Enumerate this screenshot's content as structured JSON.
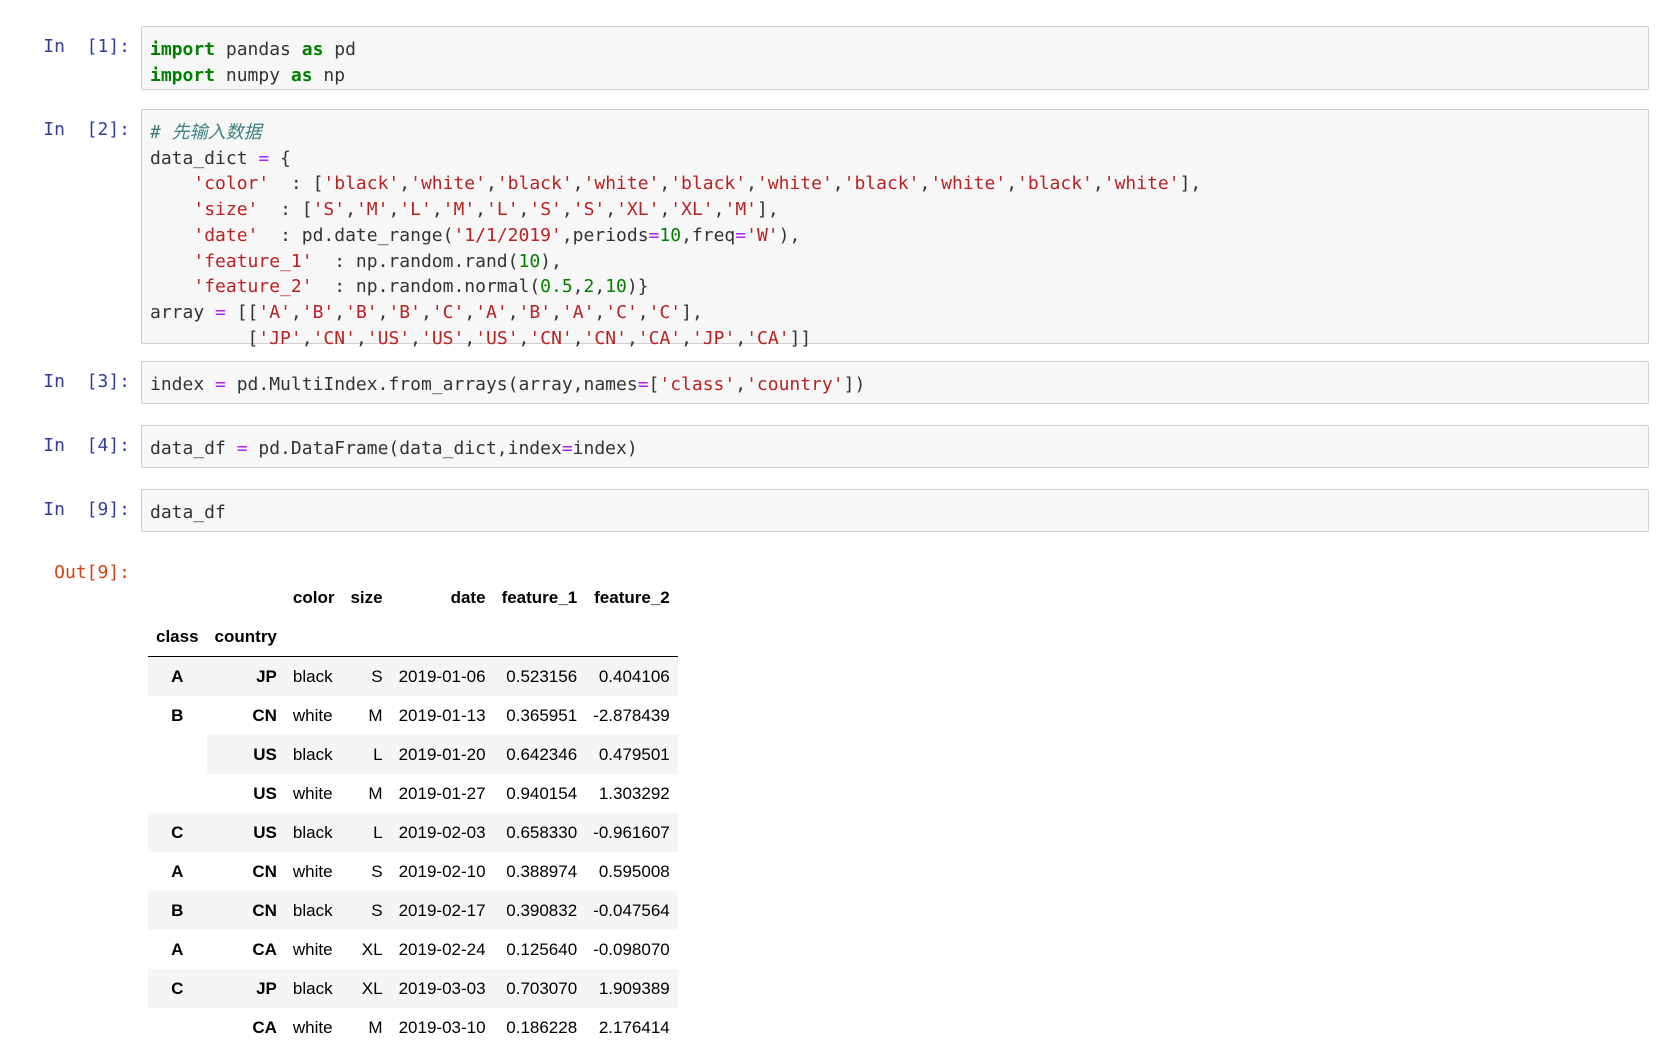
{
  "cells": [
    {
      "prompt": "In  [1]:",
      "lines": [
        [
          [
            "kw",
            "import"
          ],
          [
            "t",
            " pandas "
          ],
          [
            "kw",
            "as"
          ],
          [
            "t",
            " pd"
          ]
        ],
        [
          [
            "kw",
            "import"
          ],
          [
            "t",
            " numpy "
          ],
          [
            "kw",
            "as"
          ],
          [
            "t",
            " np"
          ]
        ]
      ]
    },
    {
      "prompt": "In  [2]:",
      "lines": [
        [
          [
            "cm",
            "# 先输入数据"
          ]
        ],
        [
          [
            "t",
            "data_dict "
          ],
          [
            "op",
            "="
          ],
          [
            "t",
            " {"
          ]
        ],
        [
          [
            "t",
            "    "
          ],
          [
            "str",
            "'color'"
          ],
          [
            "t",
            "  : ["
          ],
          [
            "str",
            "'black'"
          ],
          [
            "t",
            ","
          ],
          [
            "str",
            "'white'"
          ],
          [
            "t",
            ","
          ],
          [
            "str",
            "'black'"
          ],
          [
            "t",
            ","
          ],
          [
            "str",
            "'white'"
          ],
          [
            "t",
            ","
          ],
          [
            "str",
            "'black'"
          ],
          [
            "t",
            ","
          ],
          [
            "str",
            "'white'"
          ],
          [
            "t",
            ","
          ],
          [
            "str",
            "'black'"
          ],
          [
            "t",
            ","
          ],
          [
            "str",
            "'white'"
          ],
          [
            "t",
            ","
          ],
          [
            "str",
            "'black'"
          ],
          [
            "t",
            ","
          ],
          [
            "str",
            "'white'"
          ],
          [
            "t",
            "],"
          ]
        ],
        [
          [
            "t",
            "    "
          ],
          [
            "str",
            "'size'"
          ],
          [
            "t",
            "  : ["
          ],
          [
            "str",
            "'S'"
          ],
          [
            "t",
            ","
          ],
          [
            "str",
            "'M'"
          ],
          [
            "t",
            ","
          ],
          [
            "str",
            "'L'"
          ],
          [
            "t",
            ","
          ],
          [
            "str",
            "'M'"
          ],
          [
            "t",
            ","
          ],
          [
            "str",
            "'L'"
          ],
          [
            "t",
            ","
          ],
          [
            "str",
            "'S'"
          ],
          [
            "t",
            ","
          ],
          [
            "str",
            "'S'"
          ],
          [
            "t",
            ","
          ],
          [
            "str",
            "'XL'"
          ],
          [
            "t",
            ","
          ],
          [
            "str",
            "'XL'"
          ],
          [
            "t",
            ","
          ],
          [
            "str",
            "'M'"
          ],
          [
            "t",
            "],"
          ]
        ],
        [
          [
            "t",
            "    "
          ],
          [
            "str",
            "'date'"
          ],
          [
            "t",
            "  : pd.date_range("
          ],
          [
            "str",
            "'1/1/2019'"
          ],
          [
            "t",
            ",periods"
          ],
          [
            "op",
            "="
          ],
          [
            "num",
            "10"
          ],
          [
            "t",
            ",freq"
          ],
          [
            "op",
            "="
          ],
          [
            "str",
            "'W'"
          ],
          [
            "t",
            "),"
          ]
        ],
        [
          [
            "t",
            "    "
          ],
          [
            "str",
            "'feature_1'"
          ],
          [
            "t",
            "  : np.random.rand("
          ],
          [
            "num",
            "10"
          ],
          [
            "t",
            "),"
          ]
        ],
        [
          [
            "t",
            "    "
          ],
          [
            "str",
            "'feature_2'"
          ],
          [
            "t",
            "  : np.random.normal("
          ],
          [
            "num",
            "0.5"
          ],
          [
            "t",
            ","
          ],
          [
            "num",
            "2"
          ],
          [
            "t",
            ","
          ],
          [
            "num",
            "10"
          ],
          [
            "t",
            ")}"
          ]
        ],
        [
          [
            "t",
            "array "
          ],
          [
            "op",
            "="
          ],
          [
            "t",
            " [["
          ],
          [
            "str",
            "'A'"
          ],
          [
            "t",
            ","
          ],
          [
            "str",
            "'B'"
          ],
          [
            "t",
            ","
          ],
          [
            "str",
            "'B'"
          ],
          [
            "t",
            ","
          ],
          [
            "str",
            "'B'"
          ],
          [
            "t",
            ","
          ],
          [
            "str",
            "'C'"
          ],
          [
            "t",
            ","
          ],
          [
            "str",
            "'A'"
          ],
          [
            "t",
            ","
          ],
          [
            "str",
            "'B'"
          ],
          [
            "t",
            ","
          ],
          [
            "str",
            "'A'"
          ],
          [
            "t",
            ","
          ],
          [
            "str",
            "'C'"
          ],
          [
            "t",
            ","
          ],
          [
            "str",
            "'C'"
          ],
          [
            "t",
            "],"
          ]
        ],
        [
          [
            "t",
            "         ["
          ],
          [
            "str",
            "'JP'"
          ],
          [
            "t",
            ","
          ],
          [
            "str",
            "'CN'"
          ],
          [
            "t",
            ","
          ],
          [
            "str",
            "'US'"
          ],
          [
            "t",
            ","
          ],
          [
            "str",
            "'US'"
          ],
          [
            "t",
            ","
          ],
          [
            "str",
            "'US'"
          ],
          [
            "t",
            ","
          ],
          [
            "str",
            "'CN'"
          ],
          [
            "t",
            ","
          ],
          [
            "str",
            "'CN'"
          ],
          [
            "t",
            ","
          ],
          [
            "str",
            "'CA'"
          ],
          [
            "t",
            ","
          ],
          [
            "str",
            "'JP'"
          ],
          [
            "t",
            ","
          ],
          [
            "str",
            "'CA'"
          ],
          [
            "t",
            "]]"
          ]
        ]
      ]
    },
    {
      "prompt": "In  [3]:",
      "lines": [
        [
          [
            "t",
            "index "
          ],
          [
            "op",
            "="
          ],
          [
            "t",
            " pd.MultiIndex.from_arrays(array,names"
          ],
          [
            "op",
            "="
          ],
          [
            "t",
            "["
          ],
          [
            "str",
            "'class'"
          ],
          [
            "t",
            ","
          ],
          [
            "str",
            "'country'"
          ],
          [
            "t",
            "])"
          ]
        ]
      ]
    },
    {
      "prompt": "In  [4]:",
      "lines": [
        [
          [
            "t",
            "data_df "
          ],
          [
            "op",
            "="
          ],
          [
            "t",
            " pd.DataFrame(data_dict,index"
          ],
          [
            "op",
            "="
          ],
          [
            "t",
            "index)"
          ]
        ]
      ]
    },
    {
      "prompt": "In  [9]:",
      "lines": [
        [
          [
            "t",
            "data_df"
          ]
        ]
      ]
    }
  ],
  "output": {
    "prompt": "Out[9]:",
    "columns": [
      "color",
      "size",
      "date",
      "feature_1",
      "feature_2"
    ],
    "index_names": [
      "class",
      "country"
    ],
    "rows": [
      {
        "class": "A",
        "country": "JP",
        "values": [
          "black",
          "S",
          "2019-01-06",
          "0.523156",
          "0.404106"
        ]
      },
      {
        "class": "B",
        "country": "CN",
        "values": [
          "white",
          "M",
          "2019-01-13",
          "0.365951",
          "-2.878439"
        ]
      },
      {
        "class": "",
        "country": "US",
        "values": [
          "black",
          "L",
          "2019-01-20",
          "0.642346",
          "0.479501"
        ]
      },
      {
        "class": "",
        "country": "US",
        "values": [
          "white",
          "M",
          "2019-01-27",
          "0.940154",
          "1.303292"
        ]
      },
      {
        "class": "C",
        "country": "US",
        "values": [
          "black",
          "L",
          "2019-02-03",
          "0.658330",
          "-0.961607"
        ]
      },
      {
        "class": "A",
        "country": "CN",
        "values": [
          "white",
          "S",
          "2019-02-10",
          "0.388974",
          "0.595008"
        ]
      },
      {
        "class": "B",
        "country": "CN",
        "values": [
          "black",
          "S",
          "2019-02-17",
          "0.390832",
          "-0.047564"
        ]
      },
      {
        "class": "A",
        "country": "CA",
        "values": [
          "white",
          "XL",
          "2019-02-24",
          "0.125640",
          "-0.098070"
        ]
      },
      {
        "class": "C",
        "country": "JP",
        "values": [
          "black",
          "XL",
          "2019-03-03",
          "0.703070",
          "1.909389"
        ]
      },
      {
        "class": "",
        "country": "CA",
        "values": [
          "white",
          "M",
          "2019-03-10",
          "0.186228",
          "2.176414"
        ]
      }
    ]
  }
}
